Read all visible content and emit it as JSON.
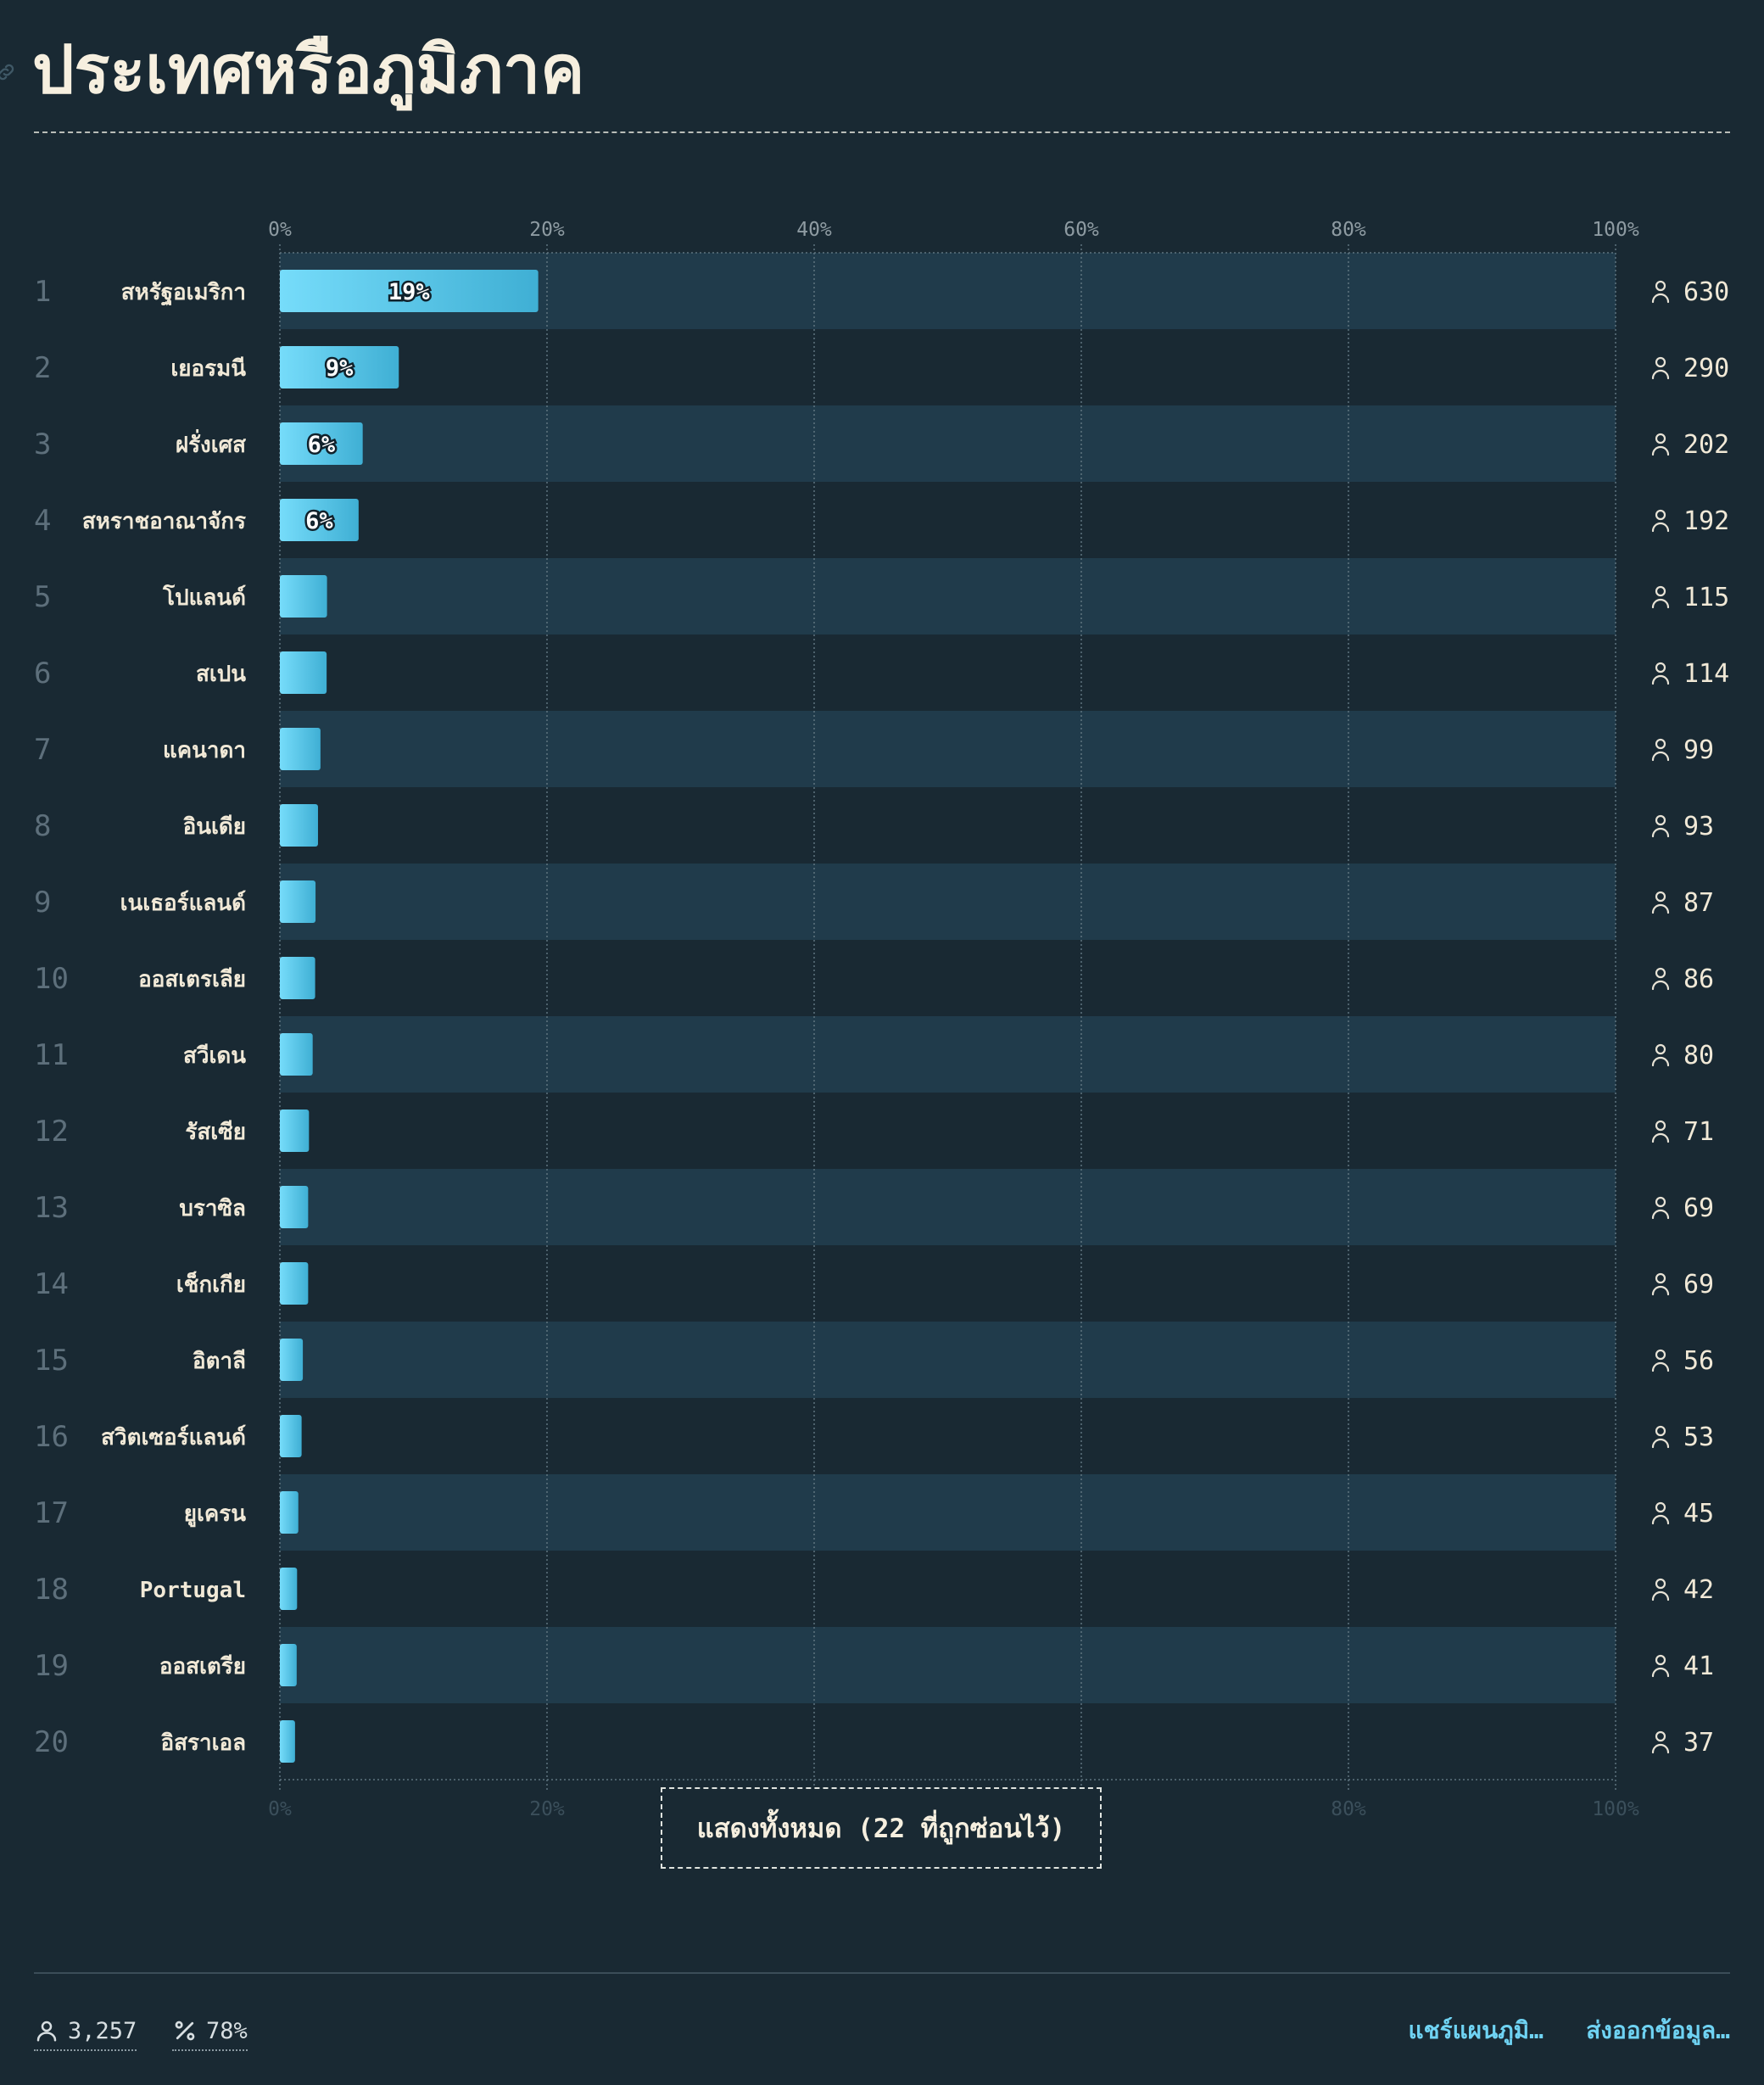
{
  "header": {
    "title": "ประเทศหรือภูมิภาค"
  },
  "chart_data": {
    "type": "bar",
    "orientation": "horizontal",
    "title": "ประเทศหรือภูมิภาค",
    "xlim": [
      0,
      100
    ],
    "x_ticks": [
      "0%",
      "20%",
      "40%",
      "60%",
      "80%",
      "100%"
    ],
    "grid": true,
    "total": 3257,
    "ranks": [
      "1",
      "2",
      "3",
      "4",
      "5",
      "6",
      "7",
      "8",
      "9",
      "10",
      "11",
      "12",
      "13",
      "14",
      "15",
      "16",
      "17",
      "18",
      "19",
      "20"
    ],
    "categories": [
      "สหรัฐอเมริกา",
      "เยอรมนี",
      "ฝรั่งเศส",
      "สหราชอาณาจักร",
      "โปแลนด์",
      "สเปน",
      "แคนาดา",
      "อินเดีย",
      "เนเธอร์แลนด์",
      "ออสเตรเลีย",
      "สวีเดน",
      "รัสเซีย",
      "บราซิล",
      "เช็กเกีย",
      "อิตาลี",
      "สวิตเซอร์แลนด์",
      "ยูเครน",
      "Portugal",
      "ออสเตรีย",
      "อิสราเอล"
    ],
    "counts": [
      630,
      290,
      202,
      192,
      115,
      114,
      99,
      93,
      87,
      86,
      80,
      71,
      69,
      69,
      56,
      53,
      45,
      42,
      41,
      37
    ],
    "count_labels": [
      "630",
      "290",
      "202",
      "192",
      "115",
      "114",
      "99",
      "93",
      "87",
      "86",
      "80",
      "71",
      "69",
      "69",
      "56",
      "53",
      "45",
      "42",
      "41",
      "37"
    ],
    "percent_labels": [
      "19%",
      "9%",
      "6%",
      "6%"
    ],
    "bar_color_start": "#76dcfa",
    "bar_color_end": "#3fafd4",
    "row_band_color": "#203b4b"
  },
  "show_all_button": {
    "label": "แสดงทั้งหมด (22 ที่ถูกซ่อนไว้)"
  },
  "footer": {
    "total_people": "3,257",
    "percent": "78%",
    "share_link": "แชร์แผนภูมิ…",
    "export_link": "ส่งออกข้อมูล…"
  },
  "icons": {
    "anchor": "link-icon",
    "person": "person-icon",
    "percent": "percent-icon"
  },
  "colors": {
    "background": "#192933",
    "accent": "#6fd3f3",
    "text": "#f3ead7"
  }
}
